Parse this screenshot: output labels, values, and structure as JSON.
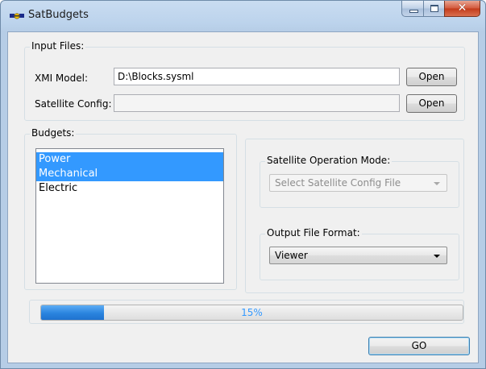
{
  "window": {
    "title": "SatBudgets",
    "icon": "satellite-icon",
    "close_glyph": "✕"
  },
  "input_files": {
    "group_title": "Input Files:",
    "xmi_model": {
      "label": "XMI Model:",
      "value": "D:\\Blocks.sysml",
      "open_label": "Open"
    },
    "satellite_config": {
      "label": "Satellite Config:",
      "value": "",
      "open_label": "Open"
    }
  },
  "budgets": {
    "group_title": "Budgets:",
    "items": [
      {
        "label": "Power",
        "selected": true
      },
      {
        "label": "Mechanical",
        "selected": true
      },
      {
        "label": "Electric",
        "selected": false
      }
    ]
  },
  "satellite_operation_mode": {
    "group_title": "Satellite Operation Mode:",
    "selected": "Select Satellite Config File",
    "enabled": false
  },
  "output_file_format": {
    "group_title": "Output File Format:",
    "selected": "Viewer",
    "enabled": true
  },
  "progress": {
    "value": 0.15,
    "text": "15%"
  },
  "go_label": "GO",
  "colors": {
    "selection": "#3399ff",
    "progress_fill": "#2a84de",
    "close_button": "#c23a1a"
  }
}
